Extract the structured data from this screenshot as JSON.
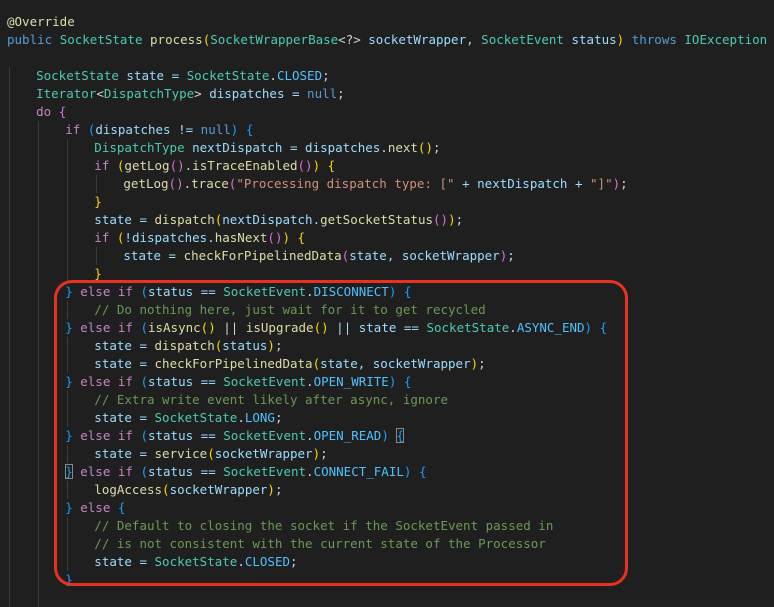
{
  "editor": {
    "language": "java",
    "lines": [
      {
        "indent": 0,
        "tokens": [
          {
            "t": "@Override",
            "c": "an"
          }
        ]
      },
      {
        "indent": 0,
        "tokens": [
          {
            "t": "public",
            "c": "kw2"
          },
          {
            "t": " ",
            "c": "p"
          },
          {
            "t": "SocketState",
            "c": "ty"
          },
          {
            "t": " ",
            "c": "p"
          },
          {
            "t": "process",
            "c": "fn"
          },
          {
            "t": "(",
            "c": "br1"
          },
          {
            "t": "SocketWrapperBase",
            "c": "ty"
          },
          {
            "t": "<?>",
            "c": "p"
          },
          {
            "t": " socketWrapper, ",
            "c": "id"
          },
          {
            "t": "SocketEvent",
            "c": "ty"
          },
          {
            "t": " status",
            "c": "id"
          },
          {
            "t": ")",
            "c": "br1"
          },
          {
            "t": " throws ",
            "c": "kw2"
          },
          {
            "t": "IOException",
            "c": "ty"
          },
          {
            "t": " ",
            "c": "p"
          },
          {
            "t": "{",
            "c": "br1"
          }
        ]
      },
      {
        "indent": 0,
        "tokens": []
      },
      {
        "indent": 1,
        "tokens": [
          {
            "t": "SocketState",
            "c": "ty"
          },
          {
            "t": " state = ",
            "c": "id"
          },
          {
            "t": "SocketState",
            "c": "ty"
          },
          {
            "t": ".",
            "c": "p"
          },
          {
            "t": "CLOSED",
            "c": "cn"
          },
          {
            "t": ";",
            "c": "p"
          }
        ]
      },
      {
        "indent": 1,
        "tokens": [
          {
            "t": "Iterator",
            "c": "ty"
          },
          {
            "t": "<",
            "c": "p"
          },
          {
            "t": "DispatchType",
            "c": "ty"
          },
          {
            "t": ">",
            "c": "p"
          },
          {
            "t": " dispatches = ",
            "c": "id"
          },
          {
            "t": "null",
            "c": "kw2"
          },
          {
            "t": ";",
            "c": "p"
          }
        ]
      },
      {
        "indent": 1,
        "tokens": [
          {
            "t": "do",
            "c": "kw"
          },
          {
            "t": " ",
            "c": "p"
          },
          {
            "t": "{",
            "c": "br2"
          }
        ]
      },
      {
        "indent": 2,
        "tokens": [
          {
            "t": "if",
            "c": "kw"
          },
          {
            "t": " ",
            "c": "p"
          },
          {
            "t": "(",
            "c": "br3"
          },
          {
            "t": "dispatches != ",
            "c": "id"
          },
          {
            "t": "null",
            "c": "kw2"
          },
          {
            "t": ")",
            "c": "br3"
          },
          {
            "t": " ",
            "c": "p"
          },
          {
            "t": "{",
            "c": "br3"
          }
        ]
      },
      {
        "indent": 3,
        "tokens": [
          {
            "t": "DispatchType",
            "c": "ty"
          },
          {
            "t": " nextDispatch = dispatches.",
            "c": "id"
          },
          {
            "t": "next",
            "c": "fn"
          },
          {
            "t": "()",
            "c": "br1"
          },
          {
            "t": ";",
            "c": "p"
          }
        ]
      },
      {
        "indent": 3,
        "tokens": [
          {
            "t": "if",
            "c": "kw"
          },
          {
            "t": " ",
            "c": "p"
          },
          {
            "t": "(",
            "c": "br1"
          },
          {
            "t": "getLog",
            "c": "fn"
          },
          {
            "t": "()",
            "c": "br2"
          },
          {
            "t": ".",
            "c": "p"
          },
          {
            "t": "isTraceEnabled",
            "c": "fn"
          },
          {
            "t": "()",
            "c": "br2"
          },
          {
            "t": ")",
            "c": "br1"
          },
          {
            "t": " ",
            "c": "p"
          },
          {
            "t": "{",
            "c": "br1"
          }
        ]
      },
      {
        "indent": 4,
        "tokens": [
          {
            "t": "getLog",
            "c": "fn"
          },
          {
            "t": "()",
            "c": "br2"
          },
          {
            "t": ".",
            "c": "p"
          },
          {
            "t": "trace",
            "c": "fn"
          },
          {
            "t": "(",
            "c": "br2"
          },
          {
            "t": "\"Processing dispatch type: [\"",
            "c": "str"
          },
          {
            "t": " + nextDispatch + ",
            "c": "id"
          },
          {
            "t": "\"]\"",
            "c": "str"
          },
          {
            "t": ")",
            "c": "br2"
          },
          {
            "t": ";",
            "c": "p"
          }
        ]
      },
      {
        "indent": 3,
        "tokens": [
          {
            "t": "}",
            "c": "br1"
          }
        ]
      },
      {
        "indent": 3,
        "tokens": [
          {
            "t": "state = ",
            "c": "id"
          },
          {
            "t": "dispatch",
            "c": "fn"
          },
          {
            "t": "(",
            "c": "br1"
          },
          {
            "t": "nextDispatch.",
            "c": "id"
          },
          {
            "t": "getSocketStatus",
            "c": "fn"
          },
          {
            "t": "()",
            "c": "br2"
          },
          {
            "t": ")",
            "c": "br1"
          },
          {
            "t": ";",
            "c": "p"
          }
        ]
      },
      {
        "indent": 3,
        "tokens": [
          {
            "t": "if",
            "c": "kw"
          },
          {
            "t": " ",
            "c": "p"
          },
          {
            "t": "(",
            "c": "br1"
          },
          {
            "t": "!dispatches.",
            "c": "id"
          },
          {
            "t": "hasNext",
            "c": "fn"
          },
          {
            "t": "()",
            "c": "br2"
          },
          {
            "t": ")",
            "c": "br1"
          },
          {
            "t": " ",
            "c": "p"
          },
          {
            "t": "{",
            "c": "br1"
          }
        ]
      },
      {
        "indent": 4,
        "tokens": [
          {
            "t": "state = ",
            "c": "id"
          },
          {
            "t": "checkForPipelinedData",
            "c": "fn"
          },
          {
            "t": "(",
            "c": "br2"
          },
          {
            "t": "state, socketWrapper",
            "c": "id"
          },
          {
            "t": ")",
            "c": "br2"
          },
          {
            "t": ";",
            "c": "p"
          }
        ]
      },
      {
        "indent": 3,
        "tokens": [
          {
            "t": "}",
            "c": "br1"
          }
        ]
      },
      {
        "indent": 2,
        "tokens": [
          {
            "t": "}",
            "c": "br3"
          },
          {
            "t": " else if ",
            "c": "kw"
          },
          {
            "t": "(",
            "c": "br3"
          },
          {
            "t": "status == ",
            "c": "id"
          },
          {
            "t": "SocketEvent",
            "c": "ty"
          },
          {
            "t": ".",
            "c": "p"
          },
          {
            "t": "DISCONNECT",
            "c": "cn"
          },
          {
            "t": ")",
            "c": "br3"
          },
          {
            "t": " ",
            "c": "p"
          },
          {
            "t": "{",
            "c": "br3"
          }
        ]
      },
      {
        "indent": 3,
        "tokens": [
          {
            "t": "// Do nothing here, just wait for it to get recycled",
            "c": "cm"
          }
        ]
      },
      {
        "indent": 2,
        "tokens": [
          {
            "t": "}",
            "c": "br3"
          },
          {
            "t": " else if ",
            "c": "kw"
          },
          {
            "t": "(",
            "c": "br3"
          },
          {
            "t": "isAsync",
            "c": "fn"
          },
          {
            "t": "()",
            "c": "br1"
          },
          {
            "t": " || ",
            "c": "p"
          },
          {
            "t": "isUpgrade",
            "c": "fn"
          },
          {
            "t": "()",
            "c": "br1"
          },
          {
            "t": " || state == ",
            "c": "id"
          },
          {
            "t": "SocketState",
            "c": "ty"
          },
          {
            "t": ".",
            "c": "p"
          },
          {
            "t": "ASYNC_END",
            "c": "cn"
          },
          {
            "t": ")",
            "c": "br3"
          },
          {
            "t": " ",
            "c": "p"
          },
          {
            "t": "{",
            "c": "br3"
          }
        ]
      },
      {
        "indent": 3,
        "tokens": [
          {
            "t": "state = ",
            "c": "id"
          },
          {
            "t": "dispatch",
            "c": "fn"
          },
          {
            "t": "(",
            "c": "br1"
          },
          {
            "t": "status",
            "c": "id"
          },
          {
            "t": ")",
            "c": "br1"
          },
          {
            "t": ";",
            "c": "p"
          }
        ]
      },
      {
        "indent": 3,
        "tokens": [
          {
            "t": "state = ",
            "c": "id"
          },
          {
            "t": "checkForPipelinedData",
            "c": "fn"
          },
          {
            "t": "(",
            "c": "br1"
          },
          {
            "t": "state, socketWrapper",
            "c": "id"
          },
          {
            "t": ")",
            "c": "br1"
          },
          {
            "t": ";",
            "c": "p"
          }
        ]
      },
      {
        "indent": 2,
        "tokens": [
          {
            "t": "}",
            "c": "br3"
          },
          {
            "t": " else if ",
            "c": "kw"
          },
          {
            "t": "(",
            "c": "br3"
          },
          {
            "t": "status == ",
            "c": "id"
          },
          {
            "t": "SocketEvent",
            "c": "ty"
          },
          {
            "t": ".",
            "c": "p"
          },
          {
            "t": "OPEN_WRITE",
            "c": "cn"
          },
          {
            "t": ")",
            "c": "br3"
          },
          {
            "t": " ",
            "c": "p"
          },
          {
            "t": "{",
            "c": "br3"
          }
        ]
      },
      {
        "indent": 3,
        "tokens": [
          {
            "t": "// Extra write event likely after async, ignore",
            "c": "cm"
          }
        ]
      },
      {
        "indent": 3,
        "tokens": [
          {
            "t": "state = ",
            "c": "id"
          },
          {
            "t": "SocketState",
            "c": "ty"
          },
          {
            "t": ".",
            "c": "p"
          },
          {
            "t": "LONG",
            "c": "cn"
          },
          {
            "t": ";",
            "c": "p"
          }
        ]
      },
      {
        "indent": 2,
        "tokens": [
          {
            "t": "}",
            "c": "br3"
          },
          {
            "t": " else if ",
            "c": "kw"
          },
          {
            "t": "(",
            "c": "br3"
          },
          {
            "t": "status == ",
            "c": "id"
          },
          {
            "t": "SocketEvent",
            "c": "ty"
          },
          {
            "t": ".",
            "c": "p"
          },
          {
            "t": "OPEN_READ",
            "c": "cn"
          },
          {
            "t": ")",
            "c": "br3"
          },
          {
            "t": " ",
            "c": "p"
          },
          {
            "t": "{",
            "c": "br3",
            "box": true
          }
        ]
      },
      {
        "indent": 3,
        "tokens": [
          {
            "t": "state = ",
            "c": "id"
          },
          {
            "t": "service",
            "c": "fn"
          },
          {
            "t": "(",
            "c": "br1"
          },
          {
            "t": "socketWrapper",
            "c": "id"
          },
          {
            "t": ")",
            "c": "br1"
          },
          {
            "t": ";",
            "c": "p"
          }
        ]
      },
      {
        "indent": 2,
        "tokens": [
          {
            "t": "}",
            "c": "br3",
            "box": true
          },
          {
            "t": " else if ",
            "c": "kw"
          },
          {
            "t": "(",
            "c": "br3"
          },
          {
            "t": "status == ",
            "c": "id"
          },
          {
            "t": "SocketEvent",
            "c": "ty"
          },
          {
            "t": ".",
            "c": "p"
          },
          {
            "t": "CONNECT_FAIL",
            "c": "cn"
          },
          {
            "t": ")",
            "c": "br3"
          },
          {
            "t": " ",
            "c": "p"
          },
          {
            "t": "{",
            "c": "br3"
          }
        ]
      },
      {
        "indent": 3,
        "tokens": [
          {
            "t": "logAccess",
            "c": "fn"
          },
          {
            "t": "(",
            "c": "br1"
          },
          {
            "t": "socketWrapper",
            "c": "id"
          },
          {
            "t": ")",
            "c": "br1"
          },
          {
            "t": ";",
            "c": "p"
          }
        ]
      },
      {
        "indent": 2,
        "tokens": [
          {
            "t": "}",
            "c": "br3"
          },
          {
            "t": " else ",
            "c": "kw"
          },
          {
            "t": "{",
            "c": "br3"
          }
        ]
      },
      {
        "indent": 3,
        "tokens": [
          {
            "t": "// Default to closing the socket if the SocketEvent passed in",
            "c": "cm"
          }
        ]
      },
      {
        "indent": 3,
        "tokens": [
          {
            "t": "// is not consistent with the current state of the Processor",
            "c": "cm"
          }
        ]
      },
      {
        "indent": 3,
        "tokens": [
          {
            "t": "state = ",
            "c": "id"
          },
          {
            "t": "SocketState",
            "c": "ty"
          },
          {
            "t": ".",
            "c": "p"
          },
          {
            "t": "CLOSED",
            "c": "cn"
          },
          {
            "t": ";",
            "c": "p"
          }
        ]
      },
      {
        "indent": 2,
        "tokens": [
          {
            "t": "}",
            "c": "br3"
          }
        ]
      },
      {
        "indent": 1,
        "tokens": []
      }
    ]
  },
  "highlight": {
    "color": "#e8321f",
    "first_line": 16,
    "last_line": 32
  }
}
